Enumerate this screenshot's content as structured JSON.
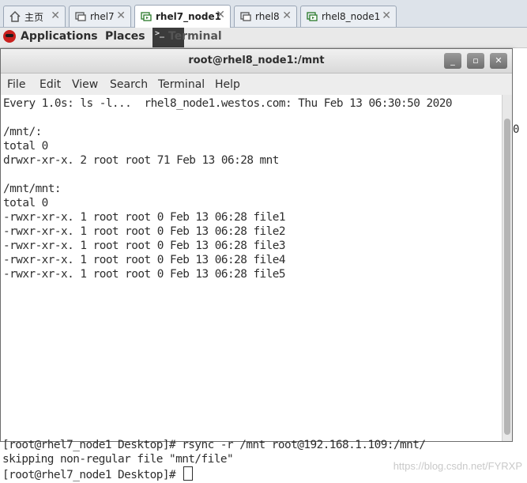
{
  "tabs": [
    {
      "label": "主页",
      "icon": "home-icon",
      "active": false
    },
    {
      "label": "rhel7",
      "icon": "vm-icon",
      "active": false
    },
    {
      "label": "rhel7_node1",
      "icon": "vm-icon",
      "active": true
    },
    {
      "label": "rhel8",
      "icon": "vm-icon",
      "active": false
    },
    {
      "label": "rhel8_node1",
      "icon": "vm-icon",
      "active": false
    }
  ],
  "gnome_bar": {
    "applications": "Applications",
    "places": "Places",
    "terminal": "Terminal"
  },
  "window": {
    "title": "root@rhel8_node1:/mnt",
    "buttons": {
      "minimize": "_",
      "maximize": "▫",
      "close": "✕"
    }
  },
  "menu": [
    "File",
    "Edit",
    "View",
    "Search",
    "Terminal",
    "Help"
  ],
  "terminal": {
    "lines": [
      "Every 1.0s: ls -l...  rhel8_node1.westos.com: Thu Feb 13 06:30:50 2020",
      "",
      "/mnt/:",
      "total 0",
      "drwxr-xr-x. 2 root root 71 Feb 13 06:28 mnt",
      "",
      "/mnt/mnt:",
      "total 0",
      "-rwxr-xr-x. 1 root root 0 Feb 13 06:28 file1",
      "-rwxr-xr-x. 1 root root 0 Feb 13 06:28 file2",
      "-rwxr-xr-x. 1 root root 0 Feb 13 06:28 file3",
      "-rwxr-xr-x. 1 root root 0 Feb 13 06:28 file4",
      "-rwxr-xr-x. 1 root root 0 Feb 13 06:28 file5"
    ]
  },
  "background_terminal": {
    "lines": [
      "[root@rhel7_node1 Desktop]# rsync -r /mnt root@192.168.1.109:/mnt/",
      "skipping non-regular file \"mnt/file\"",
      "[root@rhel7_node1 Desktop]# "
    ],
    "edge_char": "0",
    "watermark": "https://blog.csdn.net/FYRXP"
  },
  "colors": {
    "active_tab": "#ffffff",
    "tab_strip": "#dde3ea",
    "gnome_bar": "#e9e9e9",
    "terminal_text": "#2e2e2e"
  }
}
